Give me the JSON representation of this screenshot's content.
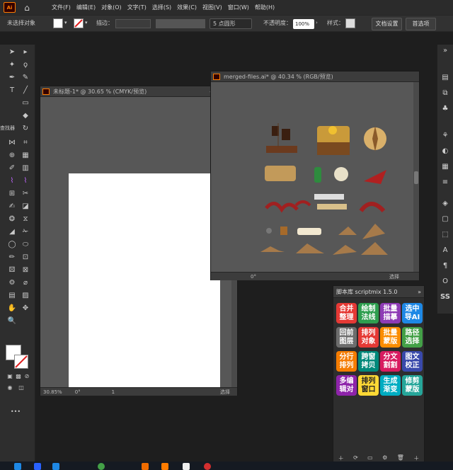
{
  "app": {
    "logo_text": "Ai"
  },
  "menu": [
    "文件(F)",
    "编辑(E)",
    "对象(O)",
    "文字(T)",
    "选择(S)",
    "效果(C)",
    "视图(V)",
    "窗口(W)",
    "帮助(H)"
  ],
  "control_bar": {
    "no_selection": "未选择对象",
    "stroke_label": "描边：",
    "brush_value": "5 点圆形",
    "opacity_label": "不透明度：",
    "opacity_value": "100%",
    "style_label": "样式：",
    "doc_setup": "文档设置",
    "preferences": "首选项"
  },
  "toolbar": {
    "find_label": "查找器"
  },
  "doc1": {
    "title": "未标题-1* @ 30.65 % (CMYK/预览)",
    "zoom": "30.85%",
    "rotation": "0°",
    "page": "1",
    "status": "选择"
  },
  "doc2": {
    "title": "merged-files.ai* @ 40.34 % (RGB/预览)",
    "rotation": "0°",
    "status": "选择"
  },
  "script_panel": {
    "title": "脚本库 scriptmix 1.5.0",
    "buttons": [
      {
        "label": "合并整理",
        "color": "#e53935"
      },
      {
        "label": "绘制法线",
        "color": "#2e9e4f"
      },
      {
        "label": "批量描摹",
        "color": "#8e3bb5"
      },
      {
        "label": "选中导AI",
        "color": "#1e88e5"
      },
      {
        "label": "回前图层",
        "color": "#6d6d6d"
      },
      {
        "label": "排列对象",
        "color": "#e53935"
      },
      {
        "label": "批量蒙版",
        "color": "#fb8c00"
      },
      {
        "label": "路径选择",
        "color": "#43a047"
      },
      {
        "label": "分行排列",
        "color": "#f57c00"
      },
      {
        "label": "跨窗拷贝",
        "color": "#00897b"
      },
      {
        "label": "分文割割",
        "color": "#d81b60"
      },
      {
        "label": "图文校正",
        "color": "#3949ab"
      },
      {
        "label": "多编辑对",
        "color": "#8e24aa"
      },
      {
        "label": "排列窗口",
        "color": "#fdd835"
      },
      {
        "label": "生成渐变",
        "color": "#00acc1"
      },
      {
        "label": "修剪蒙版",
        "color": "#26a69a"
      }
    ]
  }
}
